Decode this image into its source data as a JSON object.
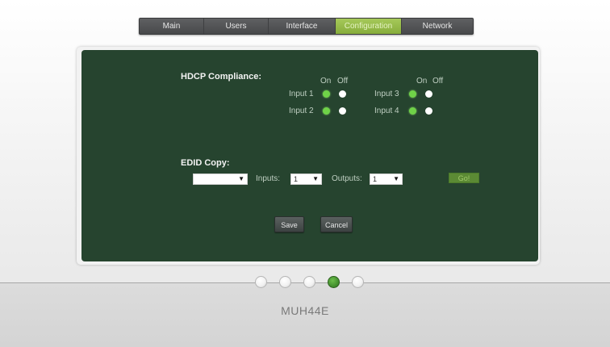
{
  "nav": {
    "tabs": [
      {
        "label": "Main",
        "active": false
      },
      {
        "label": "Users",
        "active": false
      },
      {
        "label": "Interface",
        "active": false
      },
      {
        "label": "Configuration",
        "active": true
      },
      {
        "label": "Network",
        "active": false
      }
    ]
  },
  "hdcp": {
    "title": "HDCP Compliance:",
    "on_label": "On",
    "off_label": "Off",
    "inputs": [
      {
        "label": "Input 1",
        "selected": "On"
      },
      {
        "label": "Input 2",
        "selected": "On"
      },
      {
        "label": "Input 3",
        "selected": "On"
      },
      {
        "label": "Input 4",
        "selected": "On"
      }
    ]
  },
  "edid": {
    "title": "EDID Copy:",
    "source_value": "",
    "inputs_label": "Inputs:",
    "inputs_value": "1",
    "outputs_label": "Outputs:",
    "outputs_value": "1",
    "go_label": "Go!"
  },
  "actions": {
    "save_label": "Save",
    "cancel_label": "Cancel"
  },
  "pager": {
    "page_count": 5,
    "active_index": 3
  },
  "footer": {
    "model": "MUH44E"
  },
  "colors": {
    "panel_bg": "#26442f",
    "accent_green": "#87ad3c",
    "radio_on": "#6fd248"
  },
  "icons": {
    "dropdown": "dropdown-arrow-icon"
  }
}
